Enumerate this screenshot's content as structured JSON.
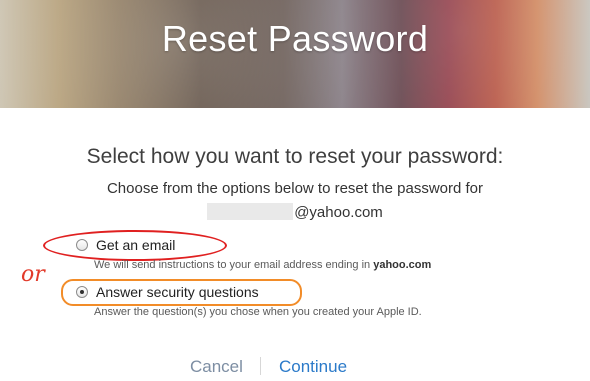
{
  "header": {
    "title": "Reset Password"
  },
  "content": {
    "headline": "Select how you want to reset your password:",
    "intro": "Choose from the options below to reset the password for",
    "email_suffix": "@yahoo.com"
  },
  "options": [
    {
      "label": "Get an email",
      "description_prefix": "We will send instructions to your email address ending in ",
      "description_highlight": "yahoo.com",
      "selected": false
    },
    {
      "label": "Answer security questions",
      "description": "Answer the question(s) you chose when you created your Apple ID.",
      "selected": true
    }
  ],
  "annotation": {
    "or_text": "or",
    "colors": {
      "red": "#e02020",
      "orange": "#f28c28"
    }
  },
  "footer": {
    "cancel": "Cancel",
    "continue": "Continue"
  }
}
